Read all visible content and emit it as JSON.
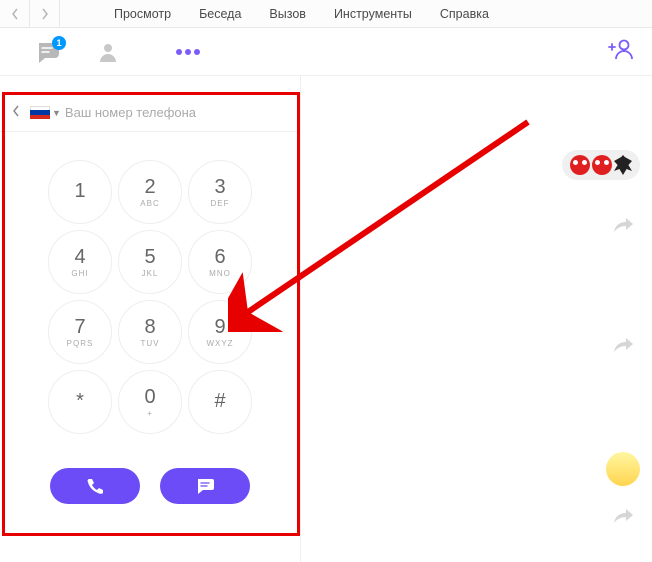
{
  "menu": {
    "items": [
      "Просмотр",
      "Беседа",
      "Вызов",
      "Инструменты",
      "Справка"
    ]
  },
  "tabbar": {
    "badge": "1"
  },
  "phone": {
    "placeholder": "Ваш номер телефона"
  },
  "keypad": {
    "keys": [
      {
        "d": "1",
        "l": ""
      },
      {
        "d": "2",
        "l": "ABC"
      },
      {
        "d": "3",
        "l": "DEF"
      },
      {
        "d": "4",
        "l": "GHI"
      },
      {
        "d": "5",
        "l": "JKL"
      },
      {
        "d": "6",
        "l": "MNO"
      },
      {
        "d": "7",
        "l": "PQRS"
      },
      {
        "d": "8",
        "l": "TUV"
      },
      {
        "d": "9",
        "l": "WXYZ"
      },
      {
        "d": "*",
        "l": ""
      },
      {
        "d": "0",
        "l": "+"
      },
      {
        "d": "#",
        "l": ""
      }
    ]
  }
}
